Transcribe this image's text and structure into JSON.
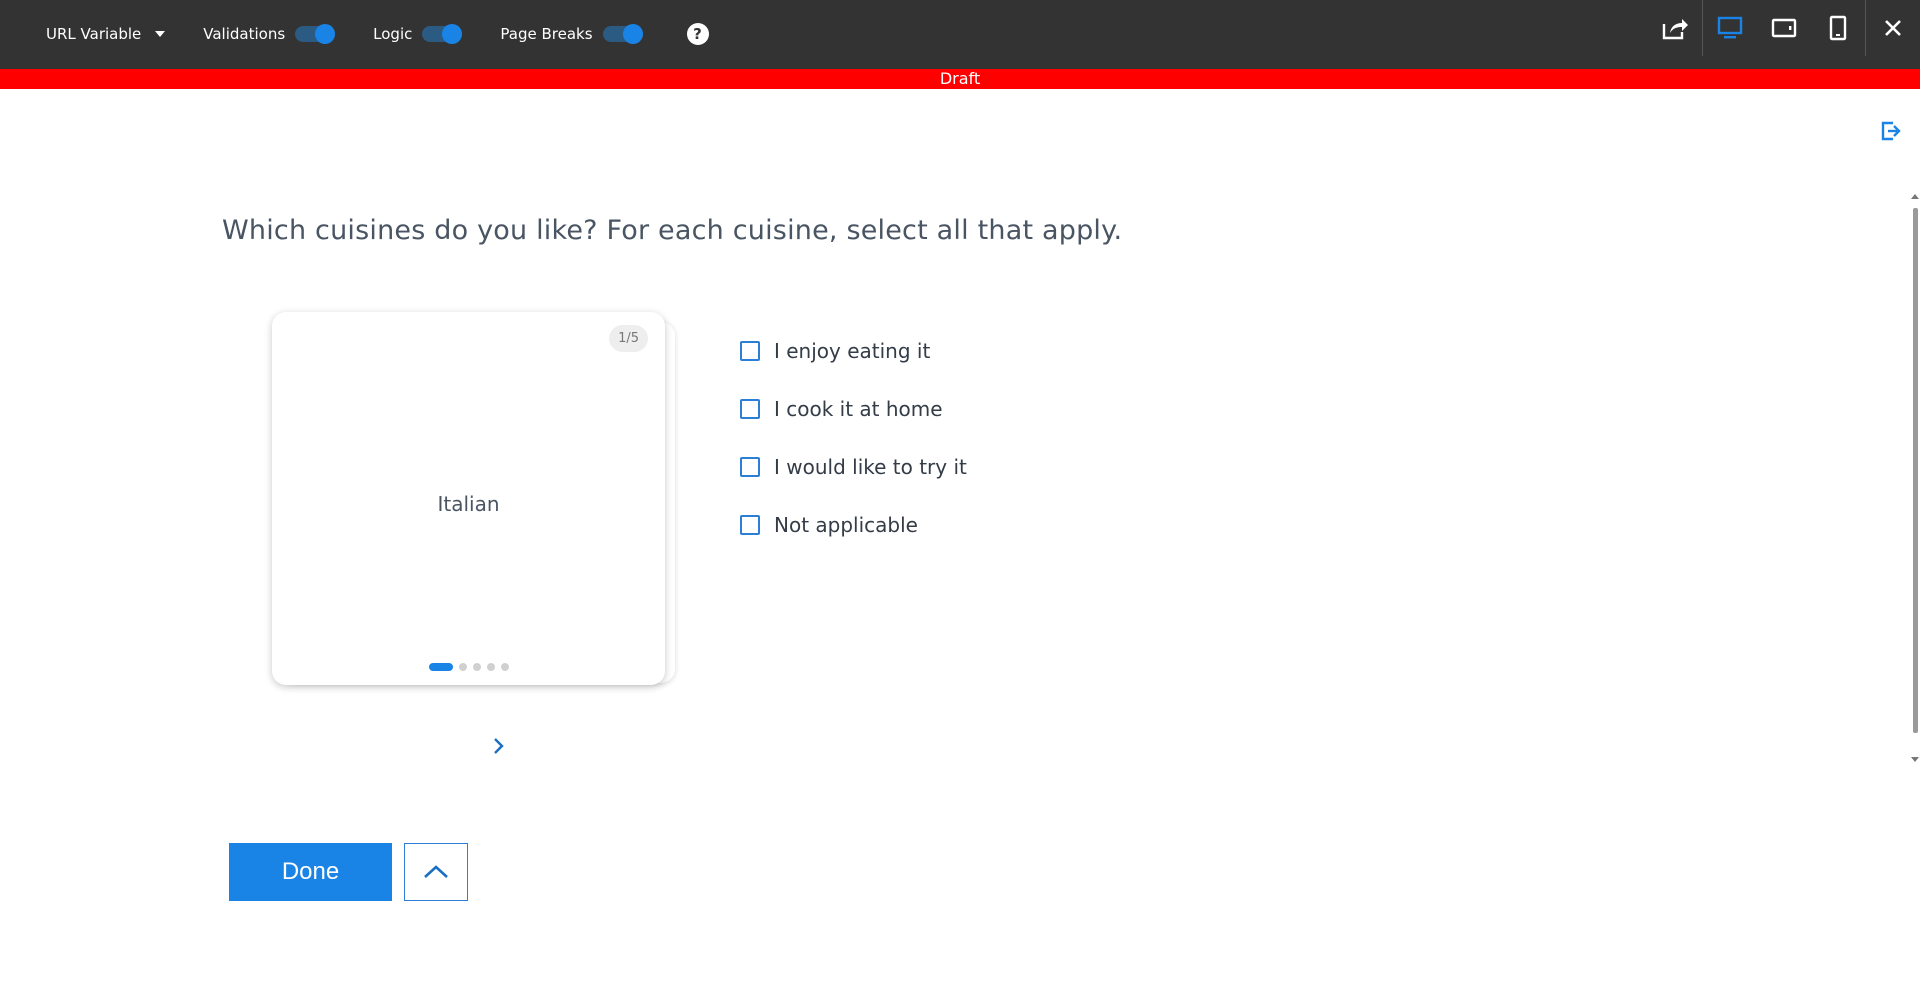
{
  "toolbar": {
    "url_variable_label": "URL Variable",
    "toggles": [
      {
        "label": "Validations",
        "on": true
      },
      {
        "label": "Logic",
        "on": true
      },
      {
        "label": "Page Breaks",
        "on": true
      }
    ],
    "help_label": "?",
    "right_icons": [
      "share-icon",
      "desktop-view-icon",
      "tablet-view-icon",
      "mobile-view-icon",
      "close-icon"
    ],
    "accent_color": "#1a84e6",
    "background_color": "#333333"
  },
  "status_banner": {
    "label": "Draft",
    "color": "#ff0000"
  },
  "question": {
    "text": "Which cuisines do you like? For each cuisine, select all that apply."
  },
  "card": {
    "counter": "1/5",
    "label": "Italian",
    "current_index": 1,
    "total": 5
  },
  "options": [
    {
      "label": "I enjoy eating it",
      "checked": false
    },
    {
      "label": "I cook it at home",
      "checked": false
    },
    {
      "label": "I would like to try it",
      "checked": false
    },
    {
      "label": "Not applicable",
      "checked": false
    }
  ],
  "actions": {
    "done_label": "Done"
  }
}
